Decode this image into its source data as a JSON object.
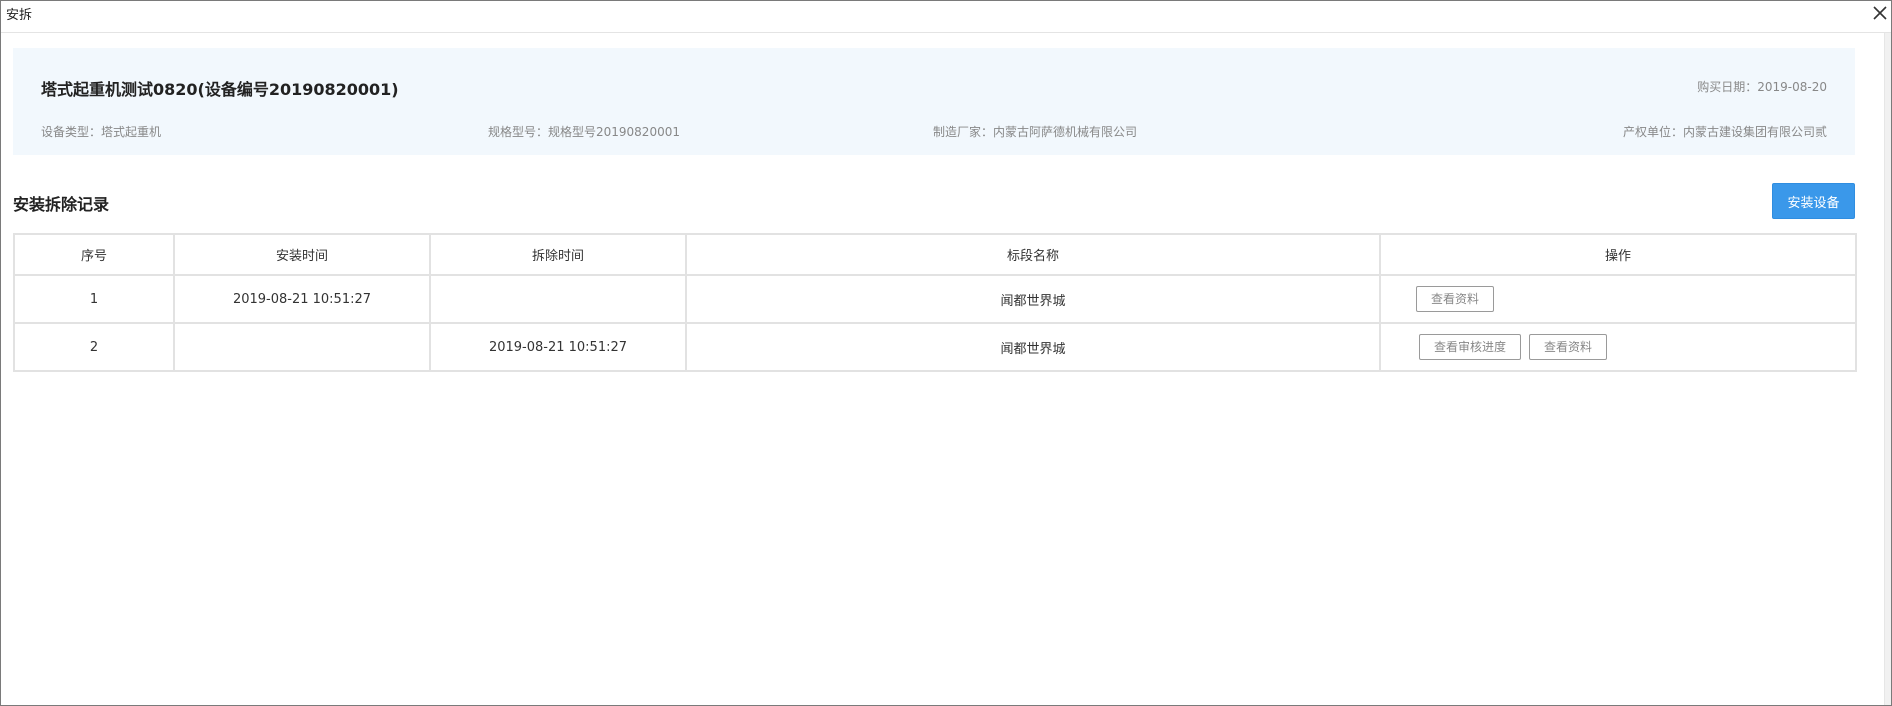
{
  "window": {
    "title": "安拆"
  },
  "equipment": {
    "title": "塔式起重机测试0820(设备编号20190820001)",
    "purchase_date": "购买日期：2019-08-20",
    "type": "设备类型：塔式起重机",
    "spec": "规格型号：规格型号20190820001",
    "maker": "制造厂家：内蒙古阿萨德机械有限公司",
    "owner": "产权单位：内蒙古建设集团有限公司贰"
  },
  "records": {
    "section_title": "安装拆除记录",
    "install_button": "安装设备",
    "columns": [
      "序号",
      "安装时间",
      "拆除时间",
      "标段名称",
      "操作"
    ],
    "rows": [
      {
        "index": "1",
        "install_time": "2019-08-21 10:51:27",
        "remove_time": "",
        "section_name": "闻都世界城",
        "actions": [
          "查看资料"
        ]
      },
      {
        "index": "2",
        "install_time": "",
        "remove_time": "2019-08-21 10:51:27",
        "section_name": "闻都世界城",
        "actions": [
          "查看审核进度",
          "查看资料"
        ]
      }
    ]
  }
}
